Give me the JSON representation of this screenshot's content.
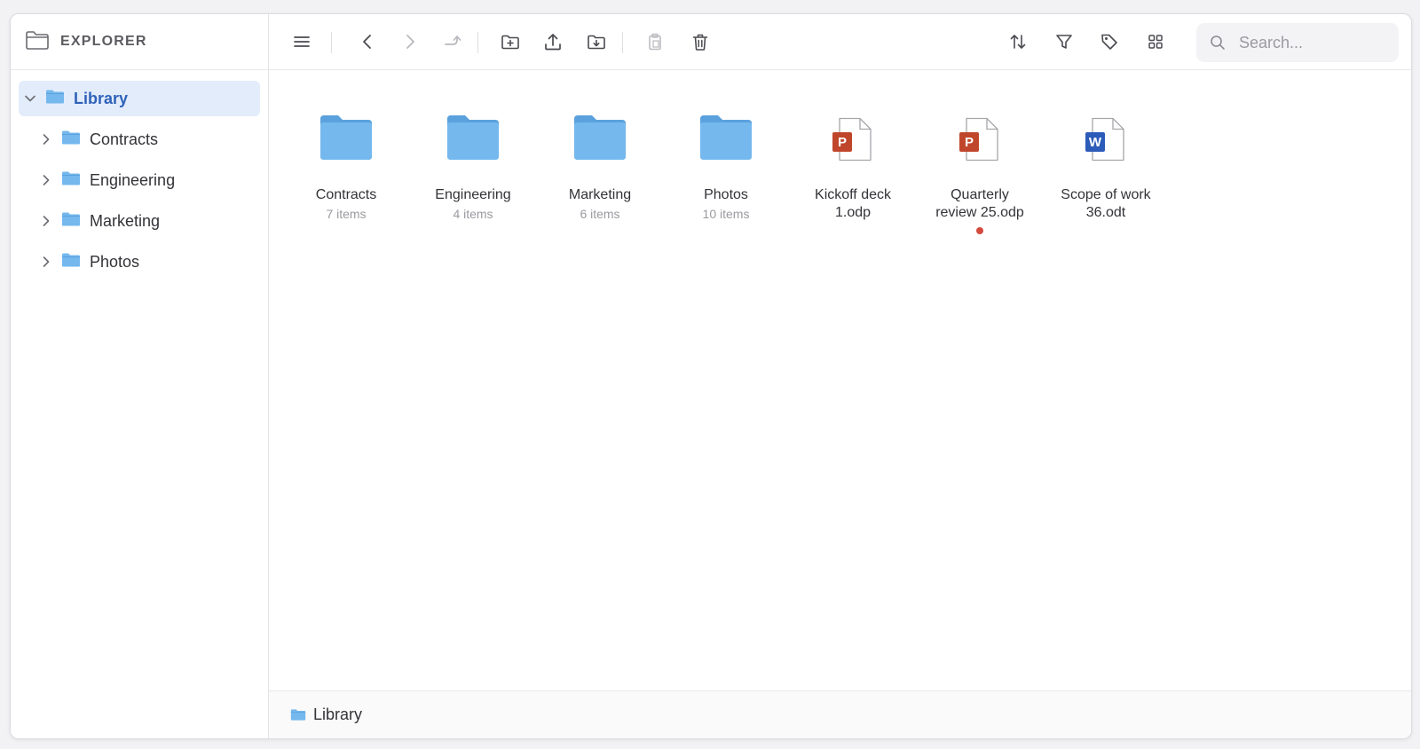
{
  "sidebar": {
    "title": "EXPLORER",
    "root": {
      "label": "Library",
      "expanded": true
    },
    "children": [
      {
        "label": "Contracts"
      },
      {
        "label": "Engineering"
      },
      {
        "label": "Marketing"
      },
      {
        "label": "Photos"
      }
    ]
  },
  "toolbar": {
    "search_placeholder": "Search..."
  },
  "content": {
    "items": [
      {
        "type": "folder",
        "name": "Contracts",
        "meta": "7 items"
      },
      {
        "type": "folder",
        "name": "Engineering",
        "meta": "4 items"
      },
      {
        "type": "folder",
        "name": "Marketing",
        "meta": "6 items"
      },
      {
        "type": "folder",
        "name": "Photos",
        "meta": "10 items"
      },
      {
        "type": "presentation",
        "badge": "P",
        "name_line1": "Kickoff deck",
        "name_line2": "1.odp"
      },
      {
        "type": "presentation",
        "badge": "P",
        "name_line1": "Quarterly",
        "name_line2": "review 25.odp",
        "modified": true
      },
      {
        "type": "document",
        "badge": "W",
        "name_line1": "Scope of work",
        "name_line2": "36.odt"
      }
    ]
  },
  "statusbar": {
    "path": "Library"
  },
  "colors": {
    "folder": "#74b8ee",
    "folder_tab": "#5aa1dd",
    "presentation_badge": "#c0462b",
    "document_badge": "#2c5bb9",
    "selected_bg": "#e2ecfb",
    "selected_text": "#2f62b8",
    "modified_dot": "#d44a3e"
  }
}
